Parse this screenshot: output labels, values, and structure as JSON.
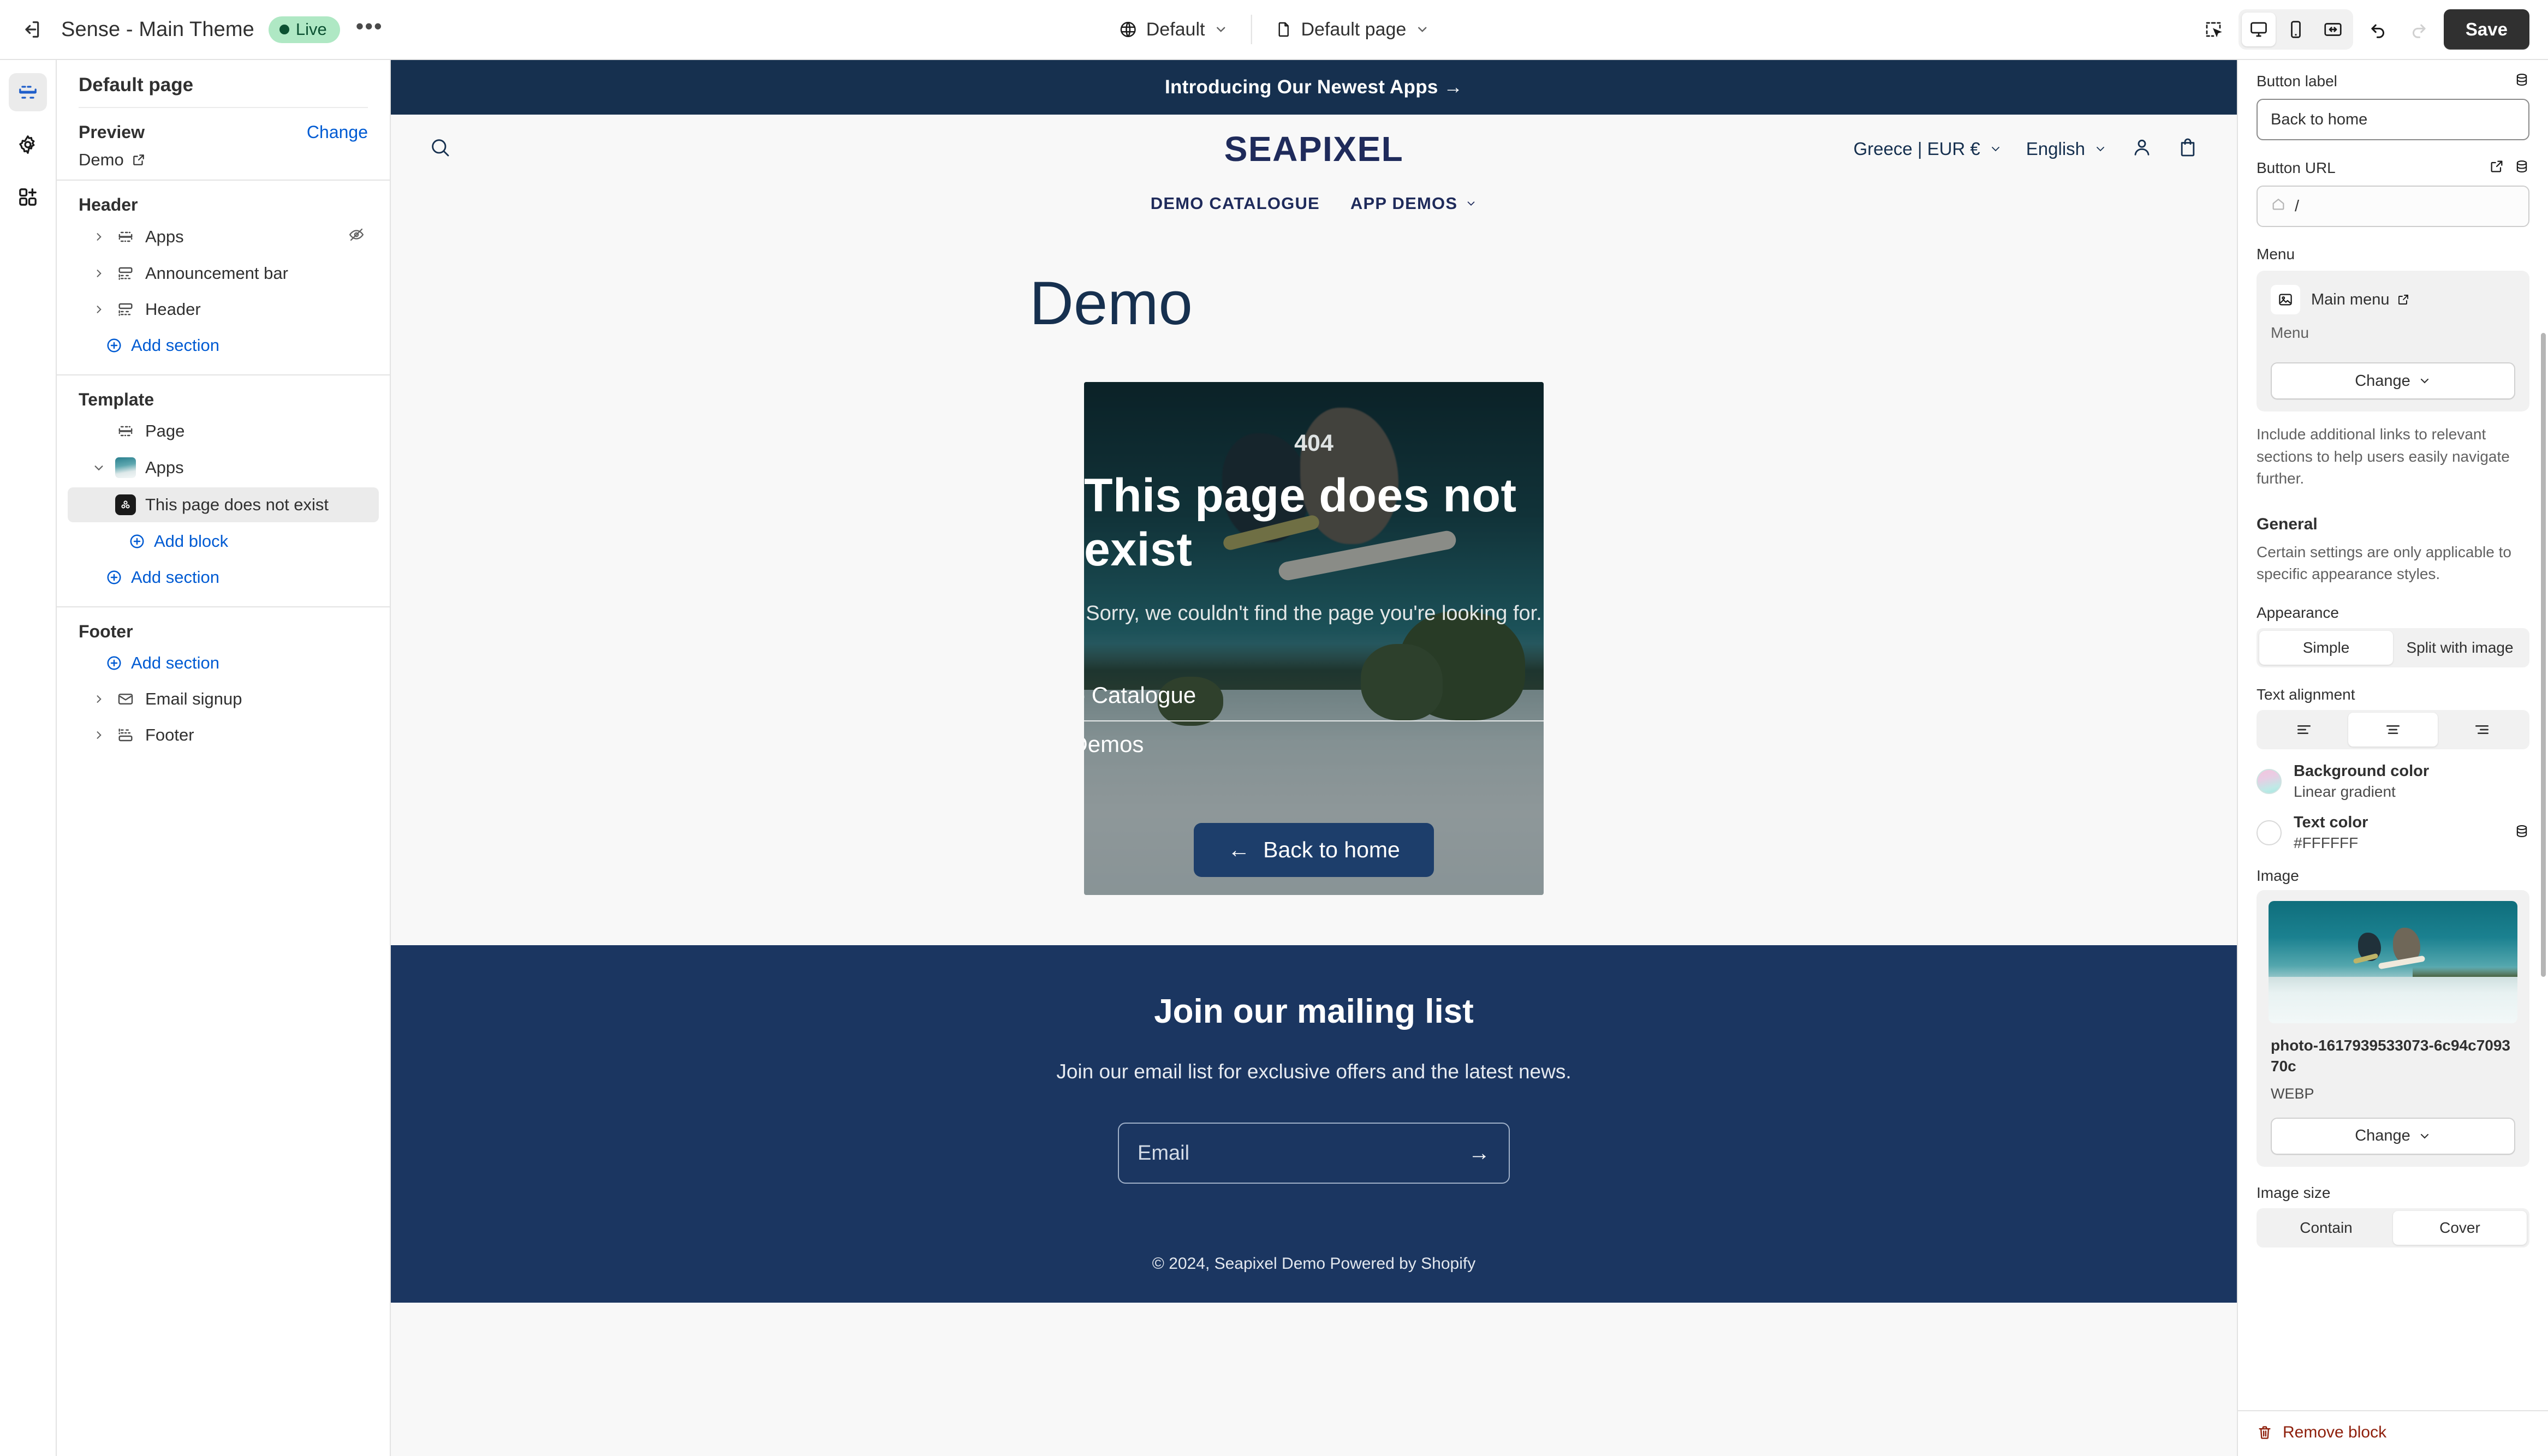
{
  "topbar": {
    "exit_icon": "exit-icon",
    "theme_name": "Sense - Main Theme",
    "status_badge": "Live",
    "more_icon": "ellipsis-icon",
    "market_selector": "Default",
    "page_selector": "Default page",
    "inspector_icon": "inspector-icon",
    "desktop_icon": "desktop-icon",
    "mobile_icon": "mobile-icon",
    "fullwidth_icon": "fullwidth-icon",
    "undo_icon": "undo-icon",
    "redo_icon": "redo-icon",
    "save_label": "Save"
  },
  "rail": {
    "sections_icon": "sections-icon",
    "settings_icon": "gear-icon",
    "apps_icon": "apps-add-icon"
  },
  "sidebar": {
    "title": "Default page",
    "preview_label": "Preview",
    "preview_change": "Change",
    "preview_value": "Demo",
    "groups": [
      {
        "name": "Header",
        "rows": [
          {
            "label": "Apps",
            "icon": "app-block-icon",
            "chevron": true,
            "hidden_icon": "eye-off-icon"
          },
          {
            "label": "Announcement bar",
            "icon": "section-icon",
            "chevron": true
          },
          {
            "label": "Header",
            "icon": "section-icon",
            "chevron": true
          }
        ],
        "add_label": "Add section"
      },
      {
        "name": "Template",
        "rows": [
          {
            "label": "Page",
            "icon": "app-block-icon",
            "chevron": false
          },
          {
            "label": "Apps",
            "icon": "app-thumb",
            "chevron": true,
            "expanded": true
          }
        ],
        "children": [
          {
            "label": "This page does not exist",
            "icon": "block-icon",
            "selected": true
          }
        ],
        "add_block_label": "Add block",
        "add_label": "Add section"
      },
      {
        "name": "Footer",
        "add_label": "Add section",
        "rows": [
          {
            "label": "Email signup",
            "icon": "envelope-icon",
            "chevron": true
          },
          {
            "label": "Footer",
            "icon": "section-icon",
            "chevron": true
          }
        ]
      }
    ]
  },
  "store": {
    "announcement": "Introducing Our Newest Apps  →",
    "search_icon": "search-icon",
    "logo": "SEAPIXEL",
    "country_currency": "Greece | EUR €",
    "language": "English",
    "account_icon": "person-icon",
    "cart_icon": "cart-icon",
    "nav": [
      {
        "label": "DEMO CATALOGUE",
        "caret": false
      },
      {
        "label": "APP DEMOS",
        "caret": true
      }
    ],
    "page_title": "Demo",
    "hero": {
      "code": "404",
      "heading": "This page does not exist",
      "subtext": "Sorry, we couldn't find the page you're looking for.",
      "links": [
        {
          "label": "Demo Catalogue",
          "arrow": "›"
        },
        {
          "label": "App Demos",
          "arrow": "›"
        }
      ],
      "button_label": "Back to home",
      "button_arrow": "←"
    },
    "footer": {
      "heading": "Join our mailing list",
      "subtext": "Join our email list for exclusive offers and the latest news.",
      "email_placeholder": "Email",
      "email_value": "",
      "submit_arrow": "→",
      "copyright": "© 2024, Seapixel Demo Powered by Shopify"
    }
  },
  "inspector": {
    "button_label_field": {
      "label": "Button label",
      "value": "Back to home",
      "dynamic_icon": "dynamic-source-icon"
    },
    "button_url_field": {
      "label": "Button URL",
      "value": "/",
      "home_icon": "home-icon",
      "external_icon": "external-link-icon",
      "dynamic_icon": "dynamic-source-icon"
    },
    "menu": {
      "label": "Menu",
      "name": "Main menu",
      "external_icon": "external-link-icon",
      "thumb_icon": "image-icon",
      "subtitle": "Menu",
      "change_label": "Change",
      "help": "Include additional links to relevant sections to help users easily navigate further."
    },
    "general": {
      "heading": "General",
      "description": "Certain settings are only applicable to specific appearance styles.",
      "appearance_label": "Appearance",
      "appearance_options": [
        "Simple",
        "Split with image"
      ],
      "appearance_selected": "Simple",
      "text_alignment_label": "Text alignment",
      "text_alignment_options": [
        "align-left-icon",
        "align-center-icon",
        "align-right-icon"
      ],
      "text_alignment_selected": "align-center-icon"
    },
    "colors": {
      "background": {
        "name": "Background color",
        "value": "Linear gradient"
      },
      "text": {
        "name": "Text color",
        "value": "#FFFFFF",
        "dynamic_icon": "dynamic-source-icon"
      }
    },
    "image": {
      "label": "Image",
      "filename": "photo-1617939533073-6c94c709370c",
      "filetype": "WEBP",
      "change_label": "Change",
      "size_label": "Image size",
      "size_options": [
        "Contain",
        "Cover"
      ],
      "size_selected": "Cover"
    },
    "remove_label": "Remove block",
    "remove_icon": "trash-icon"
  }
}
